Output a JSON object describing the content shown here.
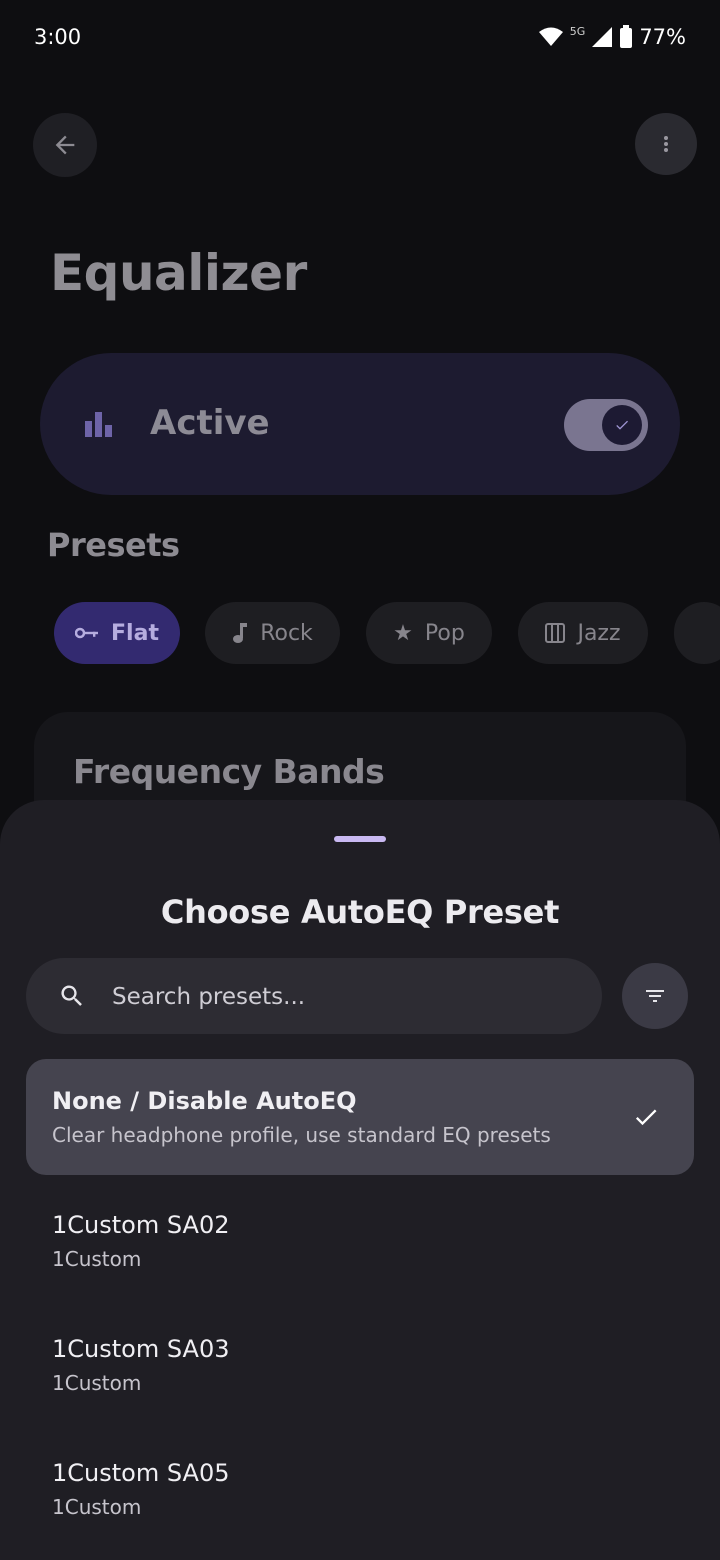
{
  "status_bar": {
    "time": "3:00",
    "network": "5G",
    "battery": "77%"
  },
  "header": {
    "back_icon": "arrow-back-icon",
    "more_icon": "more-vert-icon",
    "title": "Equalizer"
  },
  "active_card": {
    "icon": "equalizer-bars-icon",
    "label": "Active",
    "toggle_on": true
  },
  "presets": {
    "title": "Presets",
    "chips": [
      {
        "label": "Flat",
        "icon": "flat-icon",
        "selected": true
      },
      {
        "label": "Rock",
        "icon": "music-note-icon",
        "selected": false
      },
      {
        "label": "Pop",
        "icon": "star-icon",
        "selected": false
      },
      {
        "label": "Jazz",
        "icon": "piano-icon",
        "selected": false
      }
    ]
  },
  "frequency": {
    "title": "Frequency Bands"
  },
  "sheet": {
    "title": "Choose AutoEQ Preset",
    "search_placeholder": "Search presets...",
    "filter_icon": "filter-icon",
    "items": [
      {
        "name": "None / Disable AutoEQ",
        "subtitle": "Clear headphone profile, use standard EQ presets",
        "selected": true
      },
      {
        "name": "1Custom SA02",
        "subtitle": "1Custom",
        "selected": false
      },
      {
        "name": "1Custom SA03",
        "subtitle": "1Custom",
        "selected": false
      },
      {
        "name": "1Custom SA05",
        "subtitle": "1Custom",
        "selected": false
      }
    ]
  },
  "colors": {
    "accent": "#332a70",
    "handle": "#c9b9f2",
    "sheet": "#1f1e24",
    "background": "#0e0e11"
  }
}
